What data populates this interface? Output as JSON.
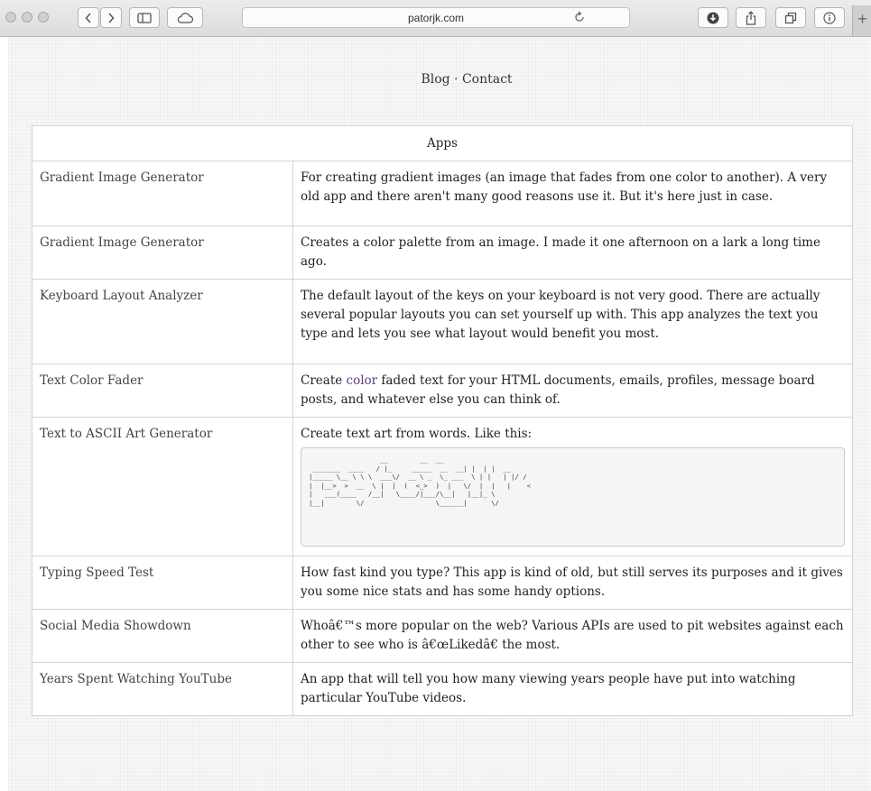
{
  "browser": {
    "url": "patorjk.com",
    "new_tab_label": "+"
  },
  "nav": {
    "blog": "Blog",
    "separator": "·",
    "contact": "Contact"
  },
  "apps": {
    "header": "Apps",
    "rows": [
      {
        "name": "Gradient Image Generator",
        "description": "For creating gradient images (an image that fades from one color to another). A very old app and there aren't many good reasons use it. But it's here just in case."
      },
      {
        "name": "Gradient Image Generator",
        "description": "Creates a color palette from an image. I made it one afternoon on a lark a long time ago."
      },
      {
        "name": "Keyboard Layout Analyzer",
        "description": "The default layout of the keys on your keyboard is not very good. There are actually several popular layouts you can set yourself up with. This app analyzes the text you type and lets you see what layout would benefit you most."
      },
      {
        "name": "Text Color Fader",
        "description_pre": "Create ",
        "description_link": "color",
        "description_post": " faded text for your HTML documents, emails, profiles, message board posts, and whatever else you can think of."
      },
      {
        "name": "Text to ASCII Art Generator",
        "description": "Create text art from words. Like this:",
        "ascii": "                  __        __  __\n _______  ____   / |_     _____  __  __| |  | |  __\n|_____ \\__ \\ \\ \\  ___\\/  __ \\ _  \\_ ___  \\ | |   | |/ /\n|  |__>  >  __  \\ |  |  (  <_>  )  |   \\/  |  |   |    <\n|   ___(____   /__|   \\____/|___/\\__|   |__|_ \\\n|__|        \\/                  \\______|      \\/"
      },
      {
        "name": "Typing Speed Test",
        "description": "How fast kind you type? This app is kind of old, but still serves its purposes and it gives you some nice stats and has some handy options."
      },
      {
        "name": "Social Media Showdown",
        "description": "Whoâ€™s more popular on the web? Various APIs are used to pit websites against each other to see who is â€œLikedâ€ the most."
      },
      {
        "name": "Years Spent Watching YouTube",
        "description": "An app that will tell you how many viewing years people have put into watching particular YouTube videos."
      }
    ]
  },
  "colors": {
    "link": "#5a3f7a",
    "border": "#d4d4d4"
  }
}
